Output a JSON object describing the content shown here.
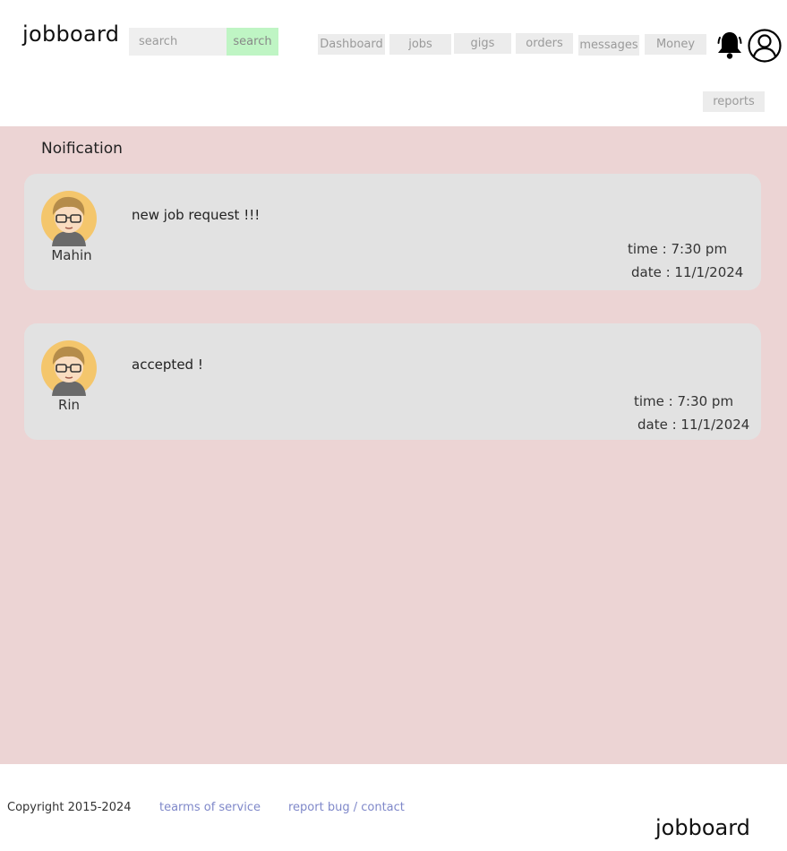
{
  "header": {
    "brand": "jobboard",
    "search": {
      "placeholder": "search",
      "button_label": "search"
    },
    "nav": [
      {
        "label": "Dashboard"
      },
      {
        "label": "jobs"
      },
      {
        "label": "gigs"
      },
      {
        "label": "orders"
      },
      {
        "label": "messages"
      },
      {
        "label": "Money"
      },
      {
        "label": "reports"
      }
    ],
    "icons": {
      "notifications": "bell-icon",
      "profile": "user-icon"
    }
  },
  "main": {
    "title": "Noification",
    "notifications": [
      {
        "user": "Mahin",
        "message": "new job request !!!",
        "time": "time : 7:30 pm",
        "date": "date : 11/1/2024"
      },
      {
        "user": "Rin",
        "message": "accepted !",
        "time": "time : 7:30 pm",
        "date": "date : 11/1/2024"
      }
    ]
  },
  "footer": {
    "copyright": "Copyright 2015-2024",
    "links": [
      "tearms of service",
      "report bug / contact"
    ],
    "brand": "jobboard"
  },
  "colors": {
    "main_bg": "#ecd4d4",
    "card_bg": "#e2e2e2",
    "search_button": "#bff5c4",
    "link": "#7f88c9"
  }
}
